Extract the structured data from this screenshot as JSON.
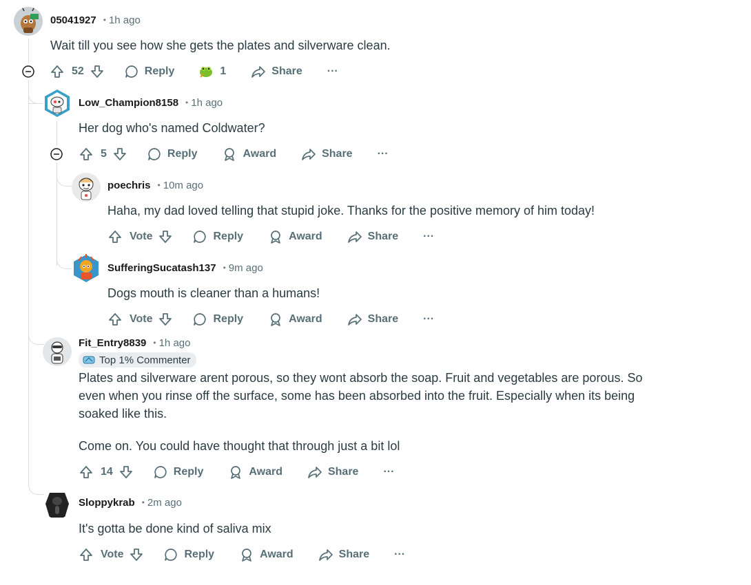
{
  "comments": [
    {
      "username": "05041927",
      "time": "1h ago",
      "body": [
        "Wait till you see how she gets the plates and silverware clean."
      ],
      "votes": "52",
      "reply_label": "Reply",
      "award_count": "1",
      "share_label": "Share",
      "more_label": "···"
    },
    {
      "username": "Low_Champion8158",
      "time": "1h ago",
      "body": [
        "Her dog who's named Coldwater?"
      ],
      "votes": "5",
      "reply_label": "Reply",
      "award_label": "Award",
      "share_label": "Share",
      "more_label": "···"
    },
    {
      "username": "poechris",
      "time": "10m ago",
      "body": [
        "Haha, my dad loved telling that stupid joke. Thanks for the positive memory of him today!"
      ],
      "votes": "Vote",
      "reply_label": "Reply",
      "award_label": "Award",
      "share_label": "Share",
      "more_label": "···"
    },
    {
      "username": "SufferingSucatash137",
      "time": "9m ago",
      "body": [
        "Dogs mouth is cleaner than a humans!"
      ],
      "votes": "Vote",
      "reply_label": "Reply",
      "award_label": "Award",
      "share_label": "Share",
      "more_label": "···"
    },
    {
      "username": "Fit_Entry8839",
      "time": "1h ago",
      "badge": "Top 1% Commenter",
      "body": [
        "Plates and silverware arent porous, so they wont absorb the soap. Fruit and vegetables are porous. So",
        "even when you rinse off the surface, some has been absorbed into the fruit. Especially when its being",
        "soaked like this.",
        "Come on. You could have thought that through just a bit lol"
      ],
      "votes": "14",
      "reply_label": "Reply",
      "award_label": "Award",
      "share_label": "Share",
      "more_label": "···"
    },
    {
      "username": "Sloppykrab",
      "time": "2m ago",
      "body": [
        "It's gotta be done kind of saliva mix"
      ],
      "votes": "Vote",
      "reply_label": "Reply",
      "award_label": "Award",
      "share_label": "Share",
      "more_label": "···"
    }
  ],
  "dot": "•",
  "colors": {
    "text": "#1a1a1b",
    "meta": "#576f76",
    "line": "#dcdcdc",
    "badge_bg": "#eaedef"
  }
}
